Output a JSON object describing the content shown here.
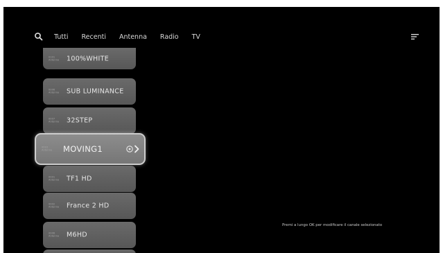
{
  "header": {
    "search_icon": "search-icon",
    "tabs": [
      {
        "label": "Tutti"
      },
      {
        "label": "Recenti"
      },
      {
        "label": "Antenna"
      },
      {
        "label": "Radio"
      },
      {
        "label": "TV"
      }
    ],
    "sort_icon": "sort-icon"
  },
  "channels": [
    {
      "number": "0101",
      "source": "Antenna",
      "name": "100%WHITE"
    },
    {
      "number": "0006",
      "source": "Antenna",
      "name": "SUB LUMINANCE"
    },
    {
      "number": "0007",
      "source": "Antenna",
      "name": "32STEP"
    },
    {
      "number": "0003",
      "source": "Antenna",
      "name": "MOVING1",
      "selected": true,
      "action_icon": "move-channel-icon"
    },
    {
      "number": "0001",
      "source": "Antenna",
      "name": "TF1 HD"
    },
    {
      "number": "0002",
      "source": "Antenna",
      "name": "France 2 HD"
    },
    {
      "number": "0006",
      "source": "Antenna",
      "name": "M6HD"
    }
  ],
  "hint": "Premi a lungo OK per modificare il canale selezionato",
  "colors": {
    "background": "#000000",
    "card": "#626262",
    "card_selected": "#828282",
    "text": "#e6e6e6"
  }
}
